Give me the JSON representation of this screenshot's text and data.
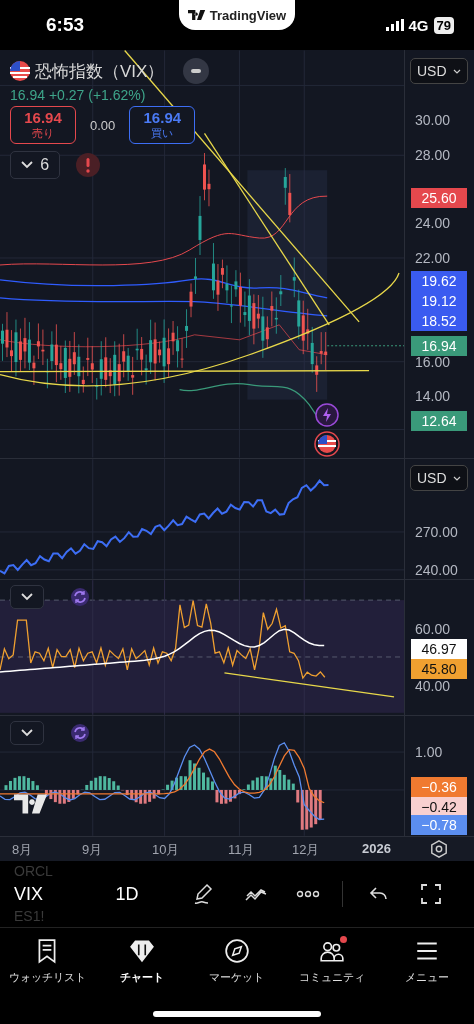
{
  "status_bar": {
    "time": "6:53",
    "network": "4G",
    "battery": "79"
  },
  "app_pill": {
    "name": "TradingView"
  },
  "main_pane": {
    "title": "恐怖指数（VIX）",
    "price_line": "16.94 +0.27 (+1.62%)",
    "sell": {
      "price": "16.94",
      "label": "売り"
    },
    "spread": "0.00",
    "buy": {
      "price": "16.94",
      "label": "買い"
    },
    "indicator_count": "6",
    "currency": "USD",
    "scale": [
      "30.00",
      "28.00",
      "24.00",
      "22.00",
      "16.00",
      "14.00"
    ],
    "tags": [
      {
        "value": "25.60",
        "color": "#e5484d"
      },
      {
        "value": "19.62",
        "color": "#3a5bf0"
      },
      {
        "value": "19.12",
        "color": "#3a5bf0"
      },
      {
        "value": "18.52",
        "color": "#3a5bf0"
      },
      {
        "value": "16.94",
        "color": "#3a9a7a"
      },
      {
        "value": "12.64",
        "color": "#3a9a7a"
      }
    ]
  },
  "pane_2": {
    "currency": "USD",
    "scale": [
      "270.00",
      "240.00"
    ]
  },
  "rsi_pane": {
    "scale": [
      "60.00",
      "40.00"
    ],
    "tags": [
      {
        "value": "46.97",
        "color": "#ffffff"
      },
      {
        "value": "45.80",
        "color": "#f0a030"
      }
    ]
  },
  "macd_pane": {
    "scale": [
      "1.00"
    ],
    "tags": [
      {
        "value": "−0.36",
        "color": "#f07a30"
      },
      {
        "value": "−0.42",
        "color": "#f8d0d0"
      },
      {
        "value": "−0.78",
        "color": "#5b8ef0"
      }
    ]
  },
  "time_axis": [
    {
      "label": "8月",
      "kind": "month"
    },
    {
      "label": "9月",
      "kind": "month"
    },
    {
      "label": "10月",
      "kind": "month"
    },
    {
      "label": "11月",
      "kind": "month"
    },
    {
      "label": "12月",
      "kind": "month"
    },
    {
      "label": "2026",
      "kind": "year"
    }
  ],
  "toolbar": {
    "symbols": [
      {
        "label": "ORCL",
        "selected": false
      },
      {
        "label": "VIX",
        "selected": true
      },
      {
        "label": "ES1!",
        "selected": false
      }
    ],
    "interval": "1D"
  },
  "tab_bar": [
    {
      "label": "ウォッチリスト",
      "selected": false,
      "notification": false
    },
    {
      "label": "チャート",
      "selected": true,
      "notification": false
    },
    {
      "label": "マーケット",
      "selected": false,
      "notification": false
    },
    {
      "label": "コミュニティ",
      "selected": false,
      "notification": true
    },
    {
      "label": "メニュー",
      "selected": false,
      "notification": false
    }
  ]
}
